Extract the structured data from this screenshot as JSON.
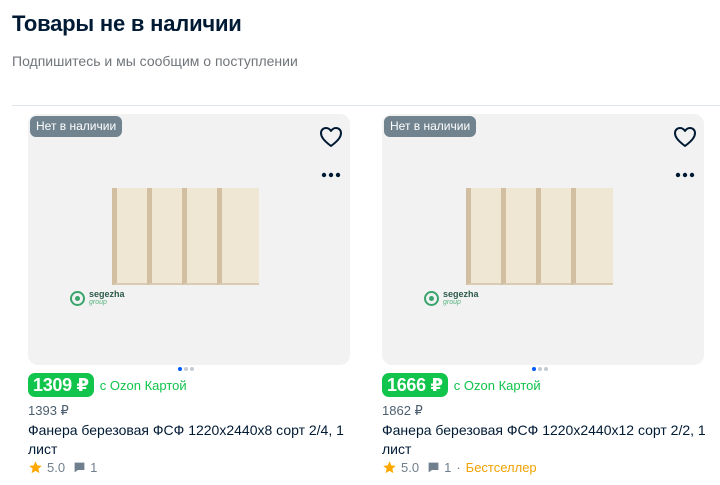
{
  "page": {
    "title": "Товары не в наличии",
    "subtitle": "Подпишитесь и мы сообщим о поступлении"
  },
  "colors": {
    "price_green": "#10c44c",
    "badge_grey": "#70838f",
    "bestseller_orange": "#f1a200",
    "text_dark": "#001a34"
  },
  "icons": {
    "favorite": "heart-icon",
    "more": "more-icon",
    "rating": "star-icon",
    "reviews": "review-icon",
    "brand": "segezha-logo"
  },
  "products": [
    {
      "stock_badge": "Нет в наличии",
      "brand_logo": "segezha",
      "brand_logo_sub": "group",
      "price": "1309 ₽",
      "price_label": "с Ozon Картой",
      "old_price": "1393 ₽",
      "name": "Фанера березовая ФСФ 1220х2440х8 сорт 2/4, 1 лист",
      "rating": "5.0",
      "reviews": "1",
      "tag": ""
    },
    {
      "stock_badge": "Нет в наличии",
      "brand_logo": "segezha",
      "brand_logo_sub": "group",
      "price": "1666 ₽",
      "price_label": "с Ozon Картой",
      "old_price": "1862 ₽",
      "name": "Фанера березовая ФСФ 1220х2440х12 сорт 2/2, 1 лист",
      "rating": "5.0",
      "reviews": "1",
      "tag": "Бестселлер"
    }
  ]
}
